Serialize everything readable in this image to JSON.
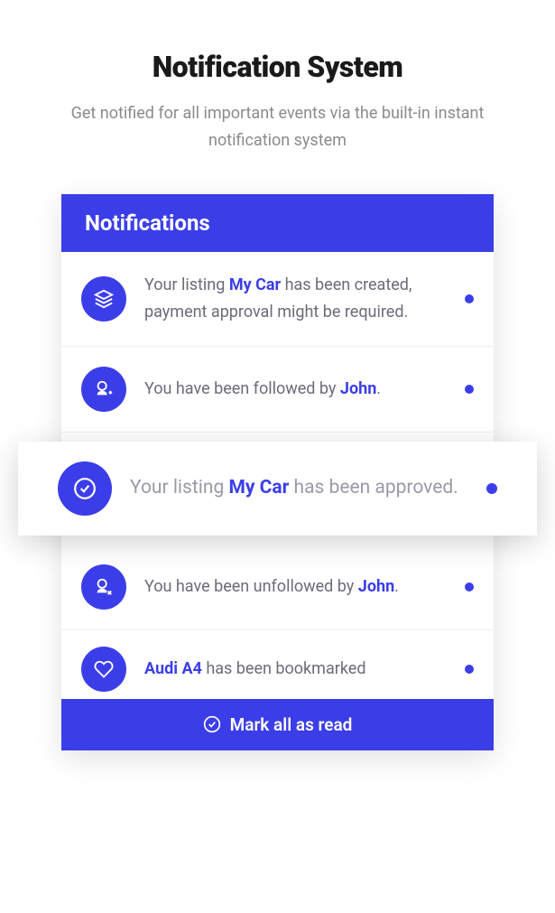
{
  "page": {
    "title": "Notification System",
    "subtitle": "Get notified for all important events via the built-in instant notification system"
  },
  "panel": {
    "header": "Notifications",
    "mark_all_label": "Mark all as read"
  },
  "notifications": [
    {
      "icon": "layers",
      "parts": [
        {
          "text": "Your listing ",
          "bold": false
        },
        {
          "text": "My Car",
          "bold": true
        },
        {
          "text": " has been created, payment approval might be required.",
          "bold": false
        }
      ],
      "unread": true,
      "highlighted": false
    },
    {
      "icon": "user-plus",
      "parts": [
        {
          "text": "You have been followed by ",
          "bold": false
        },
        {
          "text": "John",
          "bold": true
        },
        {
          "text": ".",
          "bold": false
        }
      ],
      "unread": true,
      "highlighted": false
    },
    {
      "icon": "check-circle",
      "parts": [
        {
          "text": "Your listing ",
          "bold": false
        },
        {
          "text": "My Car",
          "bold": true
        },
        {
          "text": " has been approved.",
          "bold": false
        }
      ],
      "unread": true,
      "highlighted": true
    },
    {
      "icon": "user-minus",
      "parts": [
        {
          "text": "You have been unfollowed by ",
          "bold": false
        },
        {
          "text": "John",
          "bold": true
        },
        {
          "text": ".",
          "bold": false
        }
      ],
      "unread": true,
      "highlighted": false
    },
    {
      "icon": "heart",
      "parts": [
        {
          "text": "Audi A4",
          "bold": true
        },
        {
          "text": " has been bookmarked",
          "bold": false
        }
      ],
      "unread": true,
      "highlighted": false,
      "last": true
    }
  ],
  "colors": {
    "primary": "#3b3ee8"
  }
}
